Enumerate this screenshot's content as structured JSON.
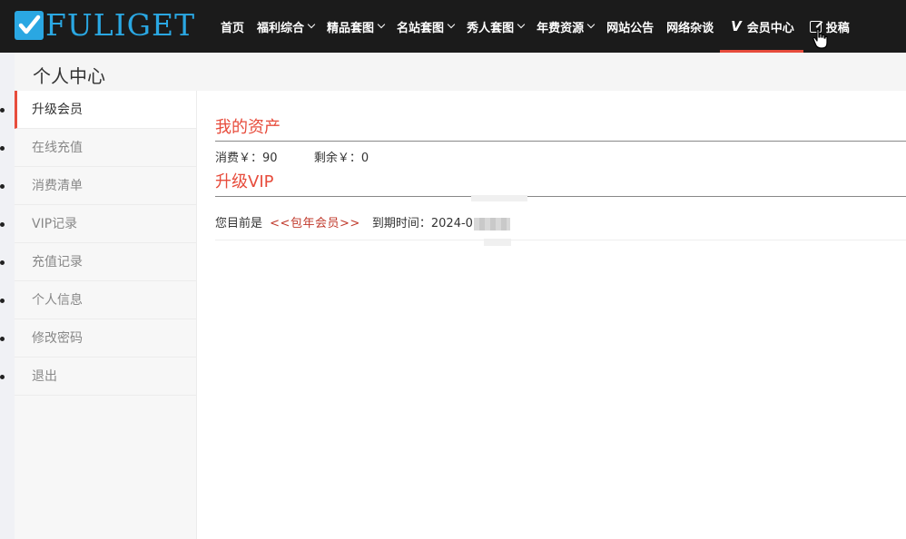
{
  "brand": {
    "logo_text": "FULIGET",
    "logo_color": "#2aa7e2"
  },
  "nav": {
    "items": [
      {
        "label": "首页",
        "dropdown": false
      },
      {
        "label": "福利综合",
        "dropdown": true
      },
      {
        "label": "精品套图",
        "dropdown": true
      },
      {
        "label": "名站套图",
        "dropdown": true
      },
      {
        "label": "秀人套图",
        "dropdown": true
      },
      {
        "label": "年费资源",
        "dropdown": true
      },
      {
        "label": "网站公告",
        "dropdown": false
      },
      {
        "label": "网络杂谈",
        "dropdown": false
      }
    ],
    "member_label": "会员中心",
    "member_icon": "V",
    "post_label": "投稿",
    "active_color": "#e74c3c"
  },
  "page": {
    "title": "个人中心"
  },
  "sidebar": {
    "items": [
      {
        "label": "升级会员",
        "active": true
      },
      {
        "label": "在线充值",
        "active": false
      },
      {
        "label": "消费清单",
        "active": false
      },
      {
        "label": "VIP记录",
        "active": false
      },
      {
        "label": "充值记录",
        "active": false
      },
      {
        "label": "个人信息",
        "active": false
      },
      {
        "label": "修改密码",
        "active": false
      },
      {
        "label": "退出",
        "active": false
      }
    ]
  },
  "assets": {
    "title": "我的资产",
    "spent_label": "消费￥：",
    "spent_value": "90",
    "balance_label": "剩余￥：",
    "balance_value": "0"
  },
  "vip": {
    "title": "升级VIP",
    "current_label": "您目前是",
    "level": "<<包年会员>>",
    "expire_label": "到期时间：",
    "expire_value": "2024-0"
  },
  "colors": {
    "accent": "#e74c3c",
    "topbar": "#1b1b1b"
  }
}
